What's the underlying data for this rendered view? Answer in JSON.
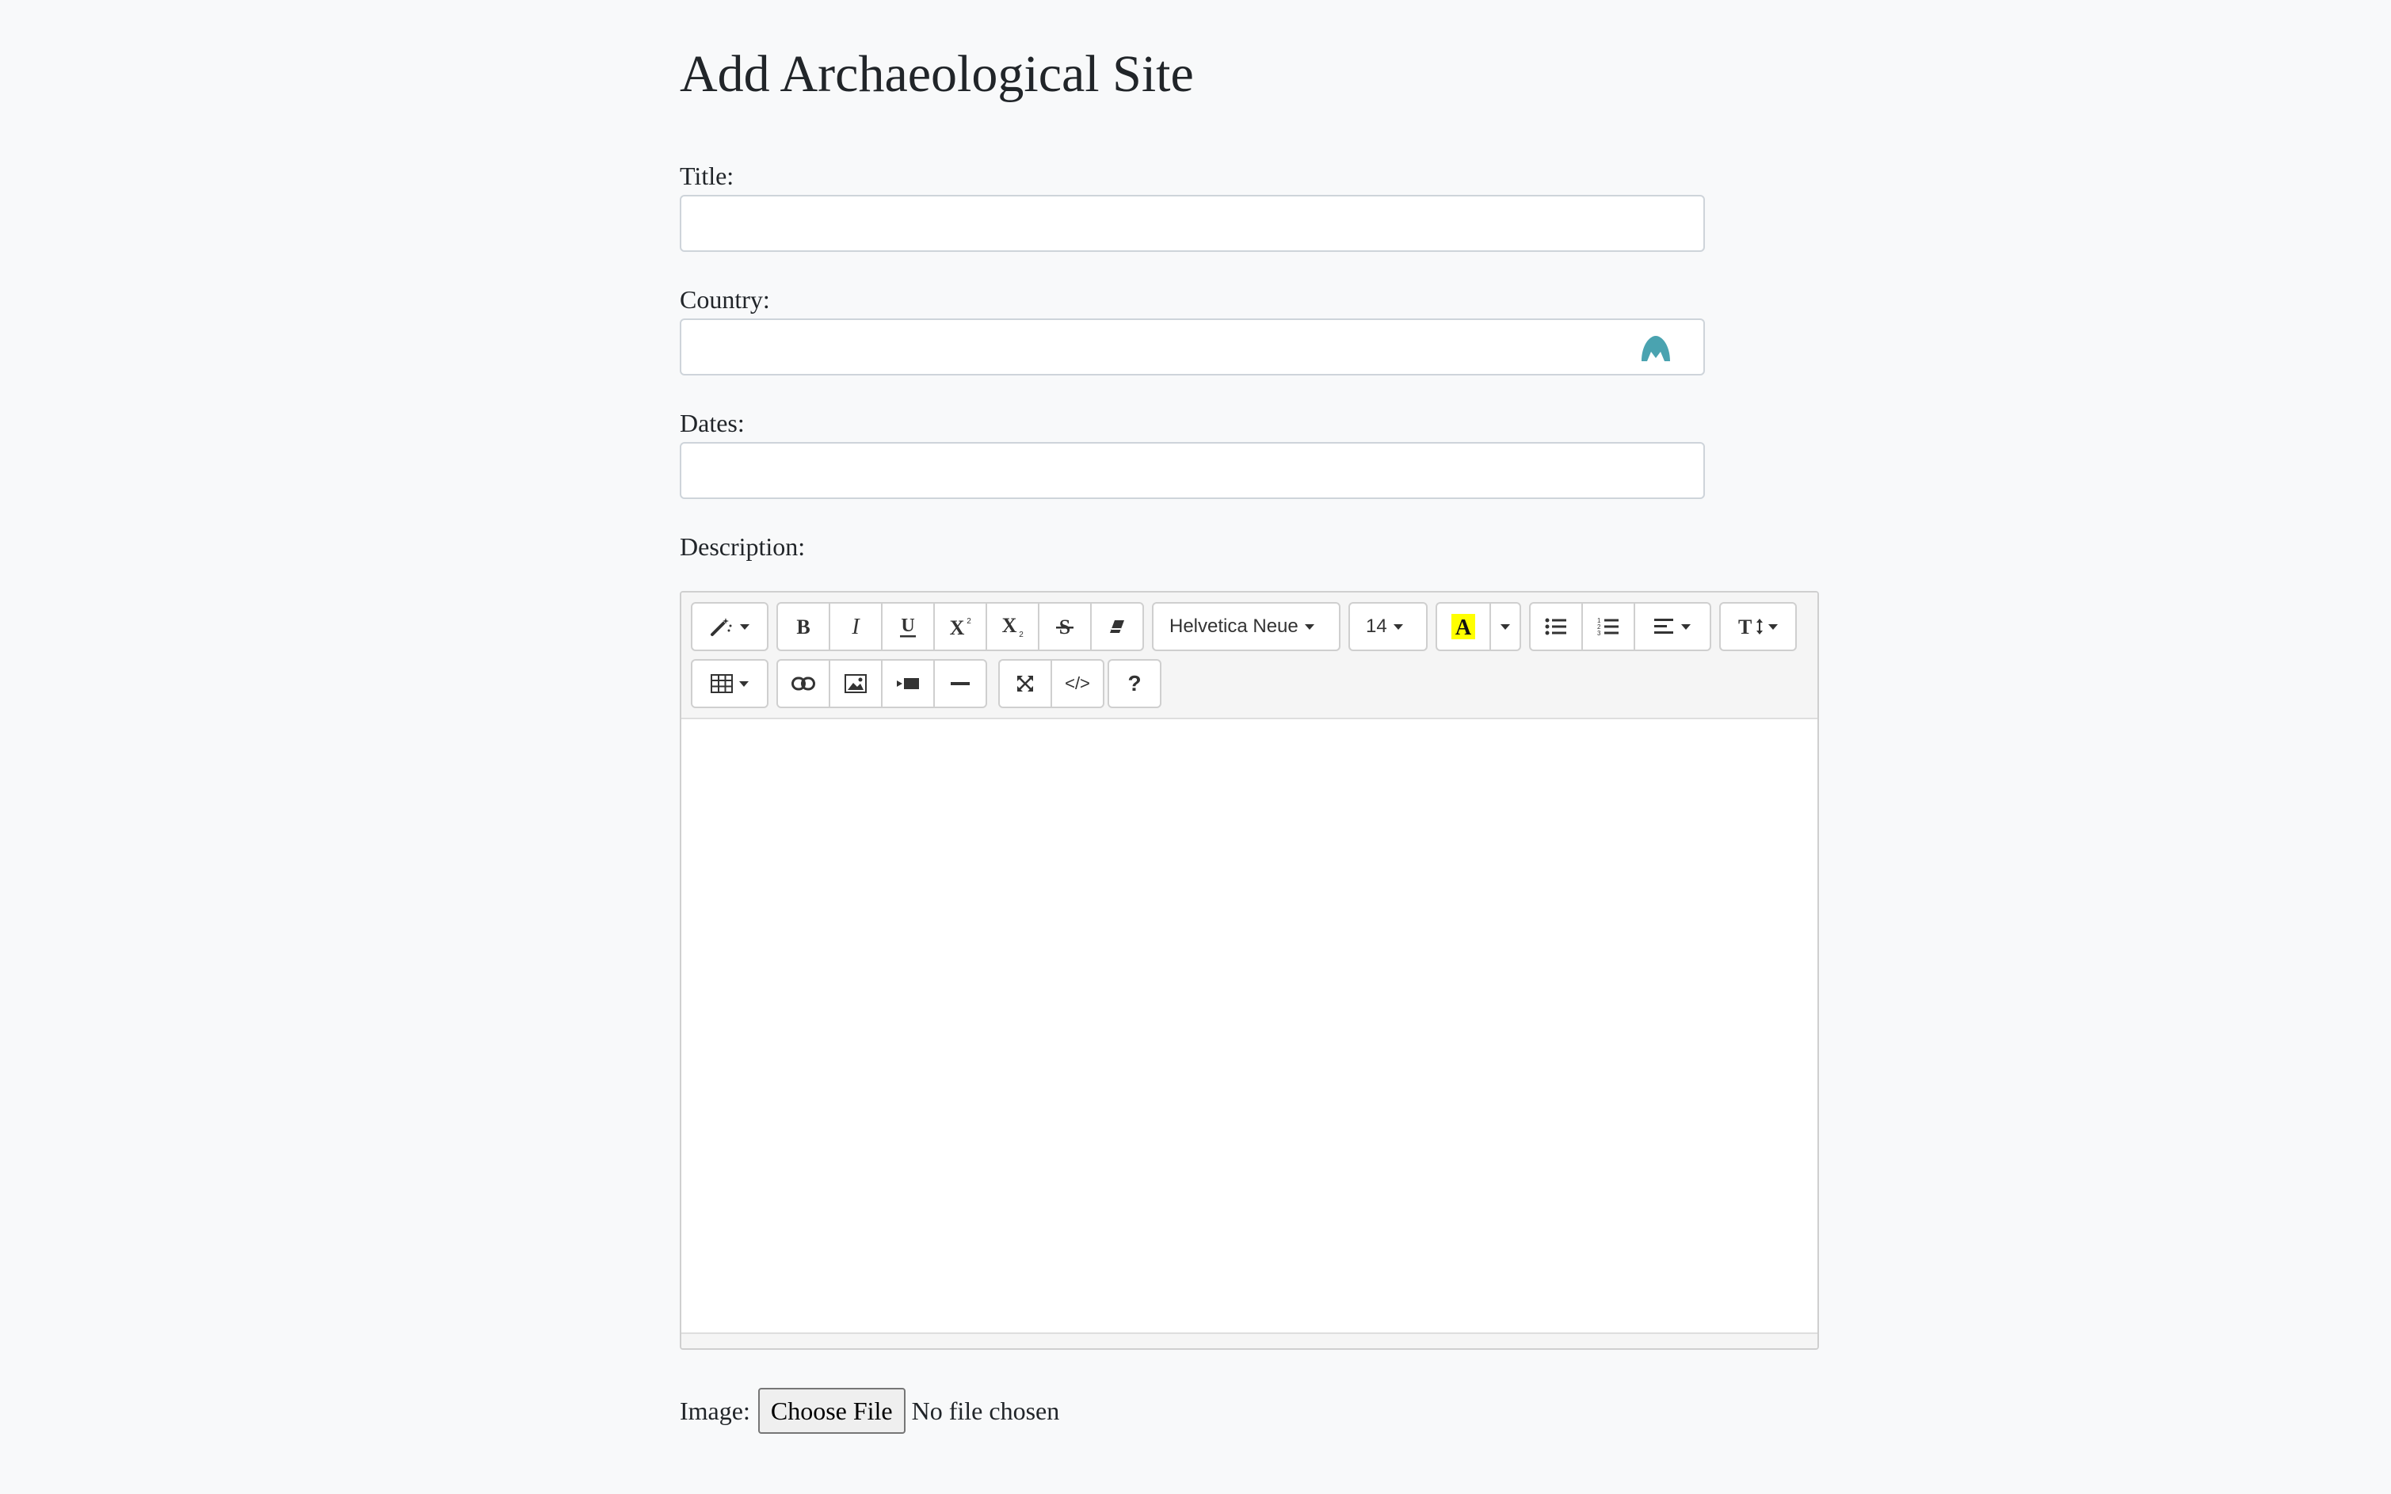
{
  "page": {
    "title": "Add Archaeological Site"
  },
  "form": {
    "title_label": "Title:",
    "title_value": "",
    "country_label": "Country:",
    "country_value": "",
    "dates_label": "Dates:",
    "dates_value": "",
    "description_label": "Description:",
    "image_label": "Image:",
    "choose_file_label": "Choose File",
    "file_status": "No file chosen"
  },
  "editor": {
    "font_name": "Helvetica Neue",
    "font_size": "14",
    "help_label": "?",
    "code_view_label": "</>",
    "icons": [
      "magic-wand-icon",
      "bold-icon",
      "italic-icon",
      "underline-icon",
      "superscript-icon",
      "subscript-icon",
      "strikethrough-icon",
      "eraser-icon",
      "text-color-icon",
      "unordered-list-icon",
      "ordered-list-icon",
      "paragraph-align-icon",
      "line-height-icon",
      "table-icon",
      "link-icon",
      "picture-icon",
      "video-icon",
      "horizontal-rule-icon",
      "fullscreen-icon",
      "code-view-icon",
      "help-icon"
    ],
    "highlight_color": "#ffff00"
  },
  "colors": {
    "background": "#f8f9fa",
    "text": "#212529",
    "input_border": "#ced4da",
    "extension_icon": "#4aa3b0"
  }
}
